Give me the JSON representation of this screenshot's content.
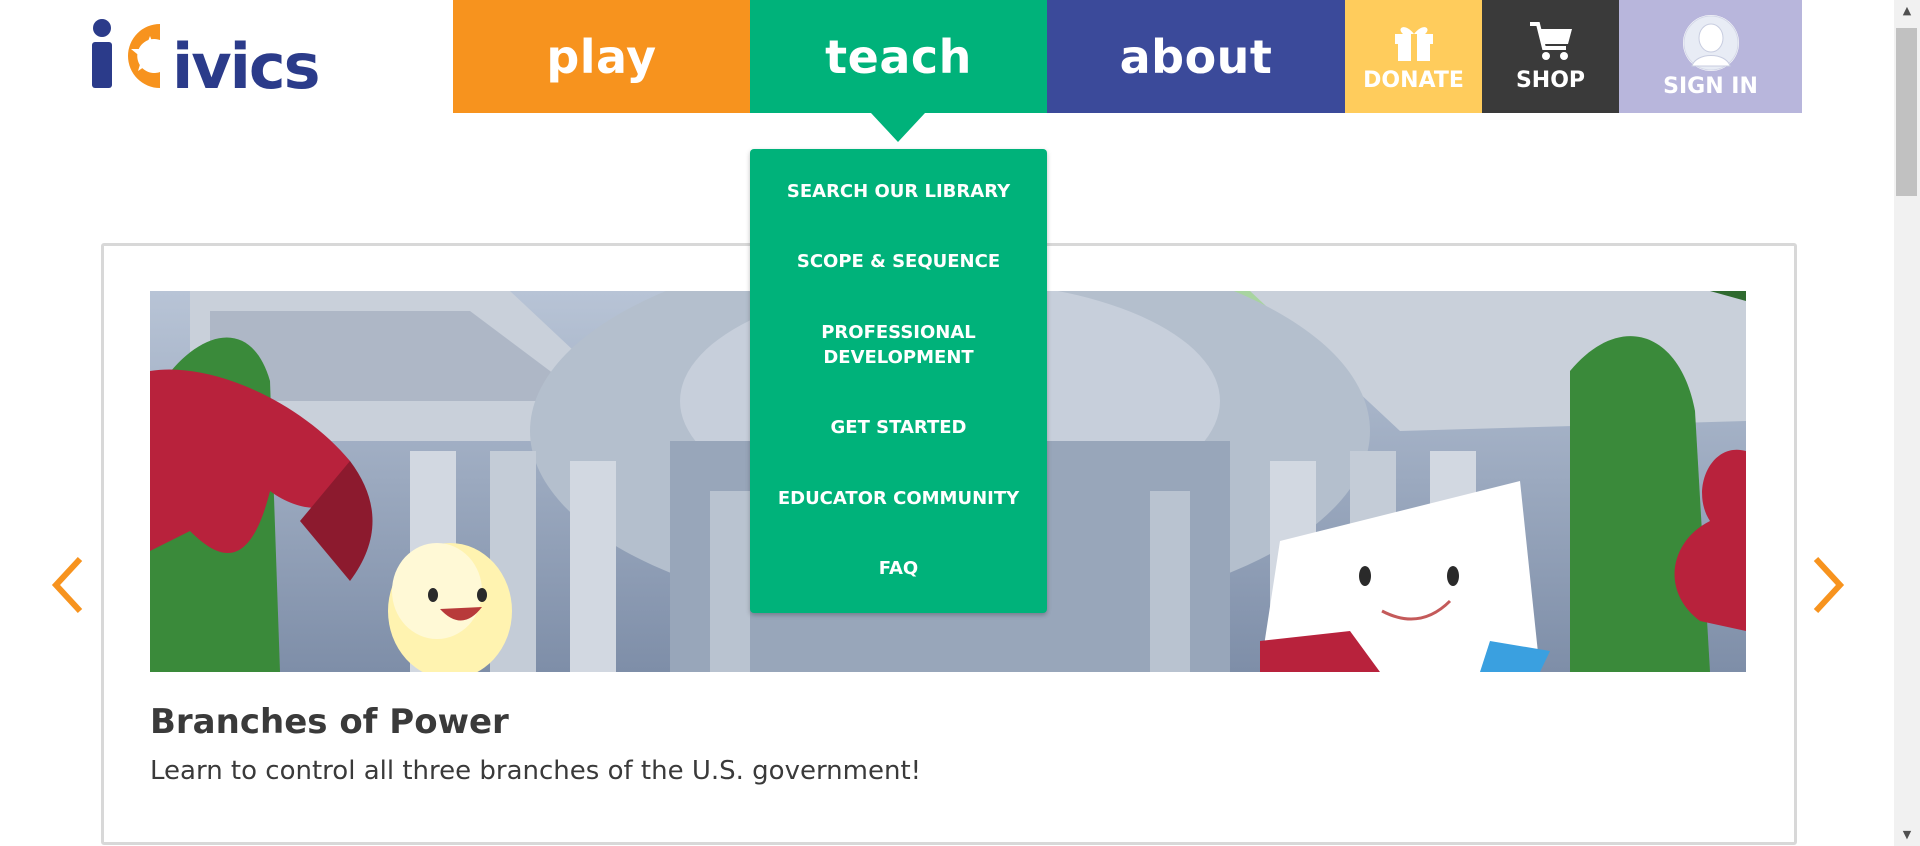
{
  "logo": {
    "text": "iCivics",
    "color": "#2b3b8a",
    "star_color": "#f7931e"
  },
  "nav": {
    "play": "play",
    "teach": "teach",
    "about": "about",
    "donate": "DONATE",
    "shop": "SHOP",
    "signin": "SIGN IN"
  },
  "nav_colors": {
    "play": "#f7931e",
    "teach": "#00b27a",
    "about": "#3b4a9a",
    "donate": "#ffcc5c",
    "shop": "#3a3a3a",
    "signin": "#b8b6dc"
  },
  "teach_menu": [
    [
      "SEARCH OUR LIBRARY"
    ],
    [
      "SCOPE & SEQUENCE"
    ],
    [
      "PROFESSIONAL",
      "DEVELOPMENT"
    ],
    [
      "GET STARTED"
    ],
    [
      "EDUCATOR COMMUNITY"
    ],
    [
      "FAQ"
    ]
  ],
  "icons": [
    "gift-icon",
    "cart-icon",
    "user-avatar-icon",
    "chevron-left-icon",
    "chevron-right-icon"
  ],
  "slide": {
    "title": "Branches of Power",
    "description": "Learn to control all three branches of the U.S. government!"
  },
  "arrow_color": "#f7931e"
}
